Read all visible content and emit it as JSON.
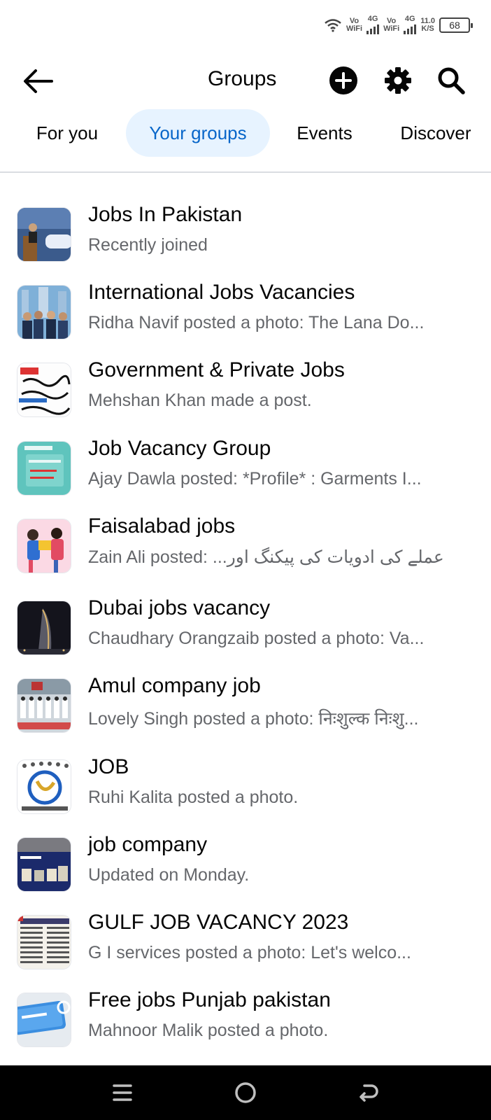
{
  "status": {
    "sim1_top": "Vo",
    "sim1_bottom": "WiFi",
    "sim1_net": "4G",
    "sim2_top": "Vo",
    "sim2_bottom": "WiFi",
    "sim2_net": "4G",
    "speed_value": "11.0",
    "speed_unit": "K/S",
    "battery": "68"
  },
  "header": {
    "title": "Groups"
  },
  "tabs": [
    {
      "label": "For you",
      "active": false
    },
    {
      "label": "Your groups",
      "active": true
    },
    {
      "label": "Events",
      "active": false
    },
    {
      "label": "Discover",
      "active": false
    }
  ],
  "groups": [
    {
      "name": "Jobs In Pakistan",
      "subtitle": "Recently joined",
      "thumb": "conference-photo"
    },
    {
      "name": "International Jobs Vacancies",
      "subtitle": "Ridha Navif posted a photo: The Lana Do...",
      "thumb": "business-team-photo"
    },
    {
      "name": "Government & Private Jobs",
      "subtitle": "Mehshan Khan made a post.",
      "thumb": "urdu-text-poster"
    },
    {
      "name": "Job Vacancy Group",
      "subtitle": "Ajay Dawla posted: *Profile* : Garments I...",
      "thumb": "need-a-job-card"
    },
    {
      "name": "Faisalabad jobs",
      "subtitle": "Zain Ali posted: ...عملے کی ادویات کی پیکنگ اور",
      "thumb": "illustration-people"
    },
    {
      "name": "Dubai jobs vacancy",
      "subtitle": "Chaudhary Orangzaib posted a photo: Va...",
      "thumb": "dubai-night-photo"
    },
    {
      "name": "Amul company job",
      "subtitle": "Lovely Singh posted a photo: निःशुल्क निःशु...",
      "thumb": "group-photo"
    },
    {
      "name": "JOB",
      "subtitle": "Ruhi Kalita posted a photo.",
      "thumb": "logo-badge"
    },
    {
      "name": "job company",
      "subtitle": "Updated on Monday.",
      "thumb": "products-slide"
    },
    {
      "name": "GULF JOB VACANCY 2023",
      "subtitle": "G I services posted a photo: Let's welco...",
      "thumb": "newspaper-clipping"
    },
    {
      "name": "Free jobs Punjab pakistan",
      "subtitle": "Mahnoor Malik posted a photo.",
      "thumb": "find-job-key"
    }
  ]
}
